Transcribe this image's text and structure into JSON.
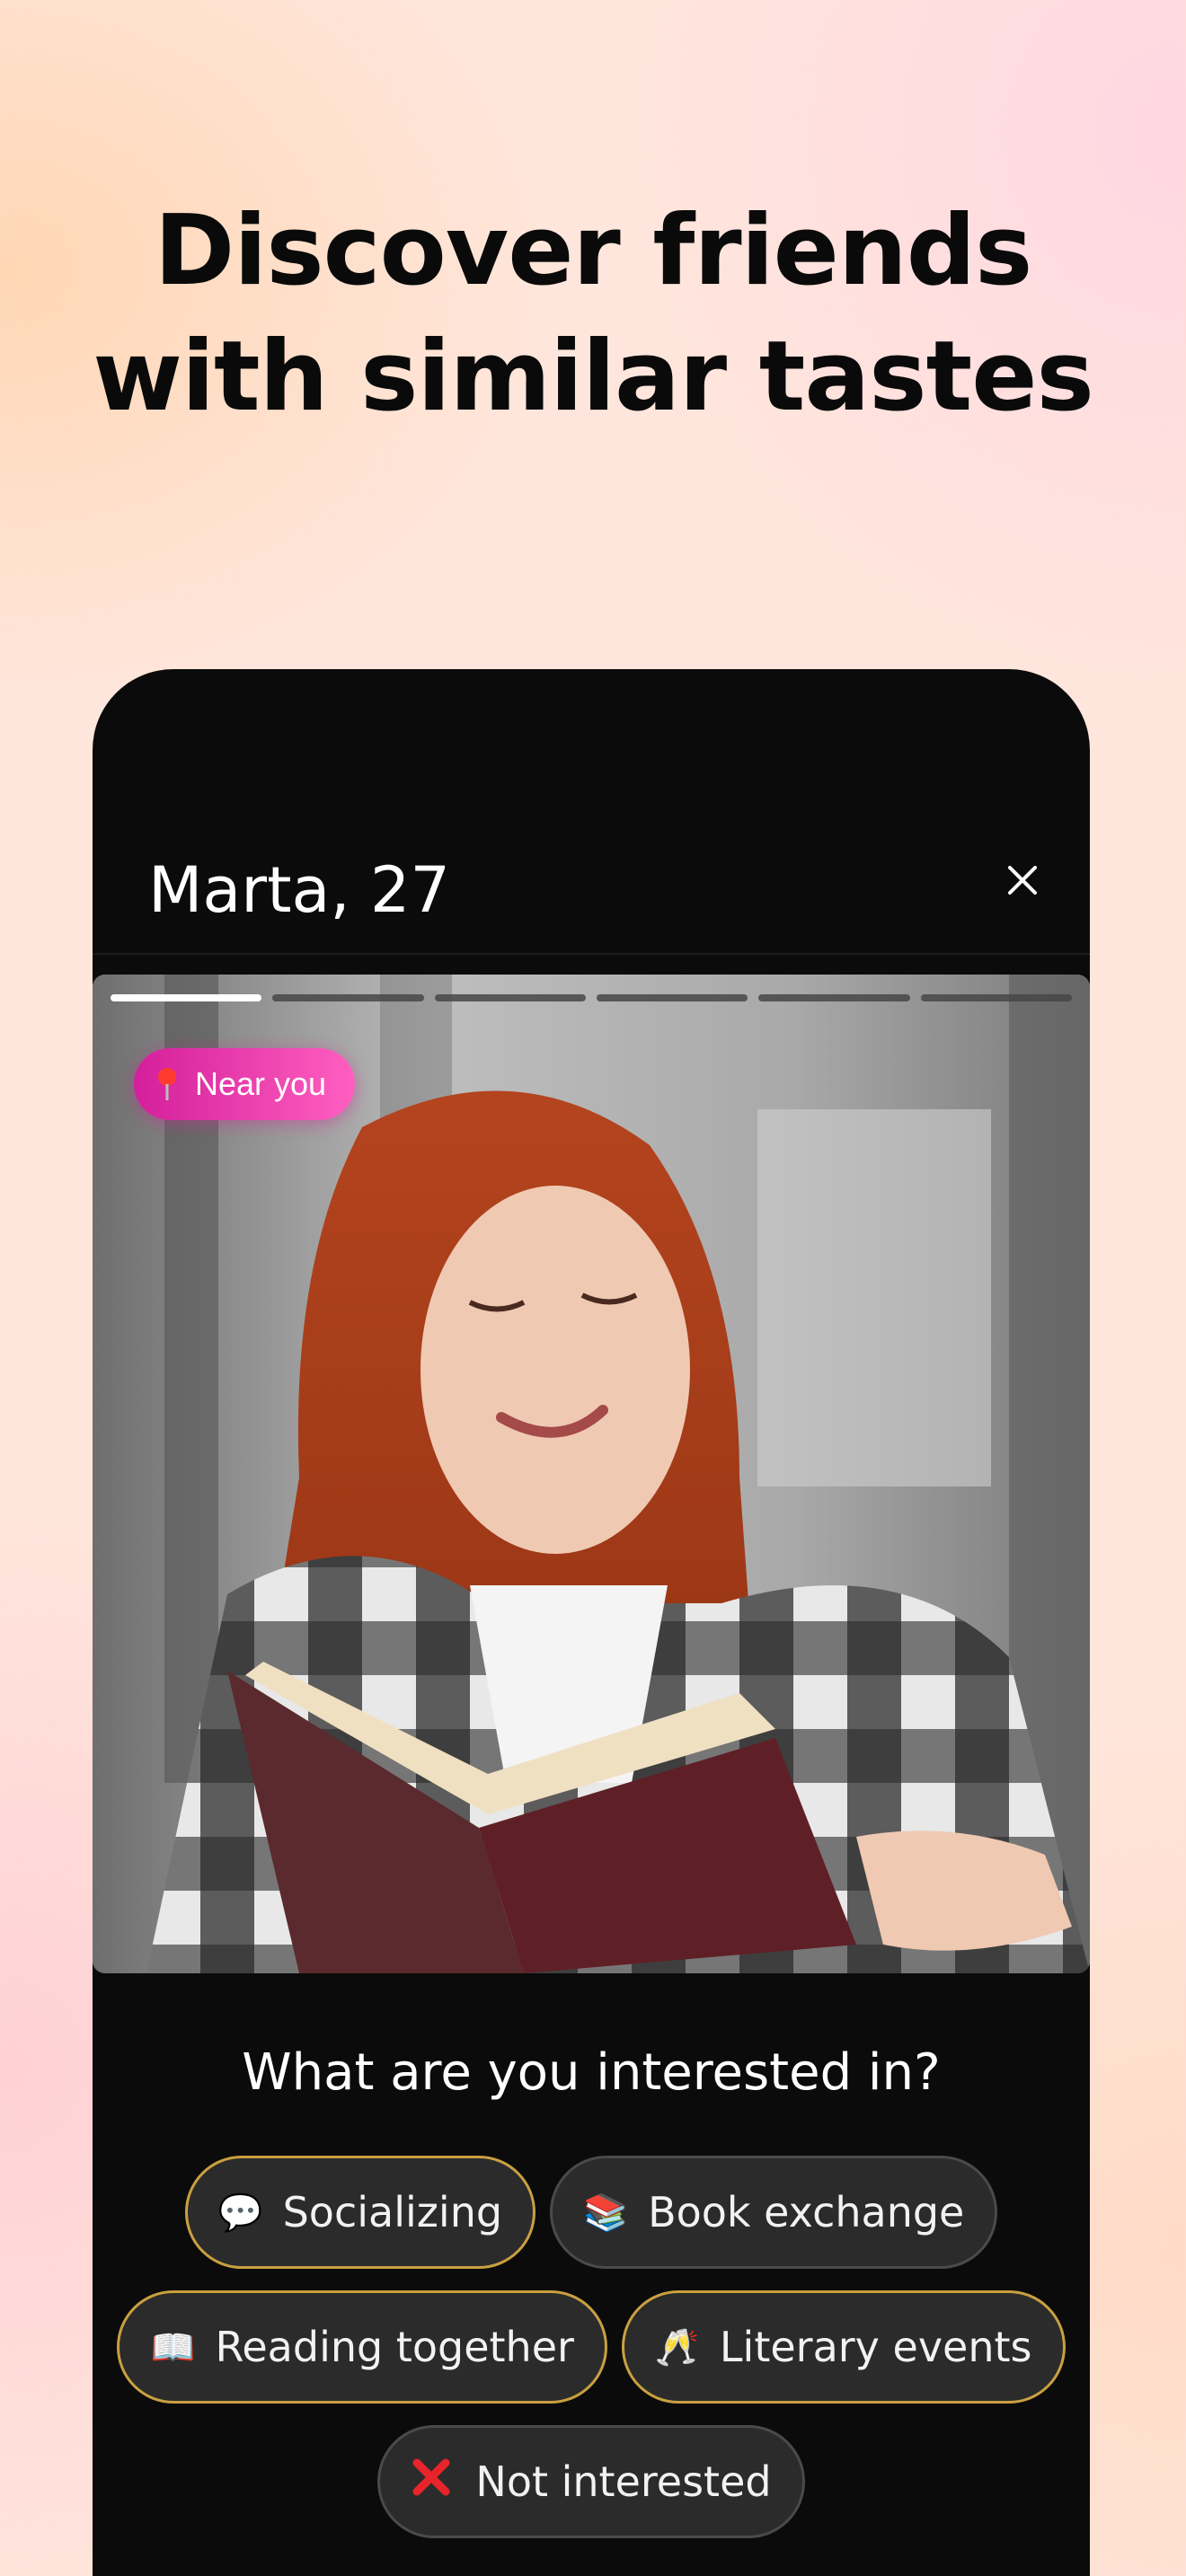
{
  "headline": {
    "line1": "Discover friends",
    "line2": "with similar tastes"
  },
  "profile": {
    "name": "Marta, 27",
    "close_icon": "close-icon",
    "photo_count": 6,
    "active_photo": 1,
    "badge": {
      "icon": "pin-icon",
      "label": "Near you"
    }
  },
  "interests": {
    "question": "What are you interested in?",
    "options": [
      {
        "icon": "speech-bubble-icon",
        "glyph": "💬",
        "label": "Socializing",
        "selected": true
      },
      {
        "icon": "books-icon",
        "glyph": "📚",
        "label": "Book exchange",
        "selected": false
      },
      {
        "icon": "open-book-icon",
        "glyph": "📖",
        "label": "Reading together",
        "selected": true
      },
      {
        "icon": "champagne-icon",
        "glyph": "🥂",
        "label": "Literary events",
        "selected": true
      },
      {
        "icon": "red-x-icon",
        "glyph": "❌",
        "label": "Not interested",
        "selected": false
      }
    ]
  },
  "colors": {
    "accent_pink": "#e0299f",
    "selected_border": "#c9a040",
    "card_bg": "#0b0b0b"
  }
}
